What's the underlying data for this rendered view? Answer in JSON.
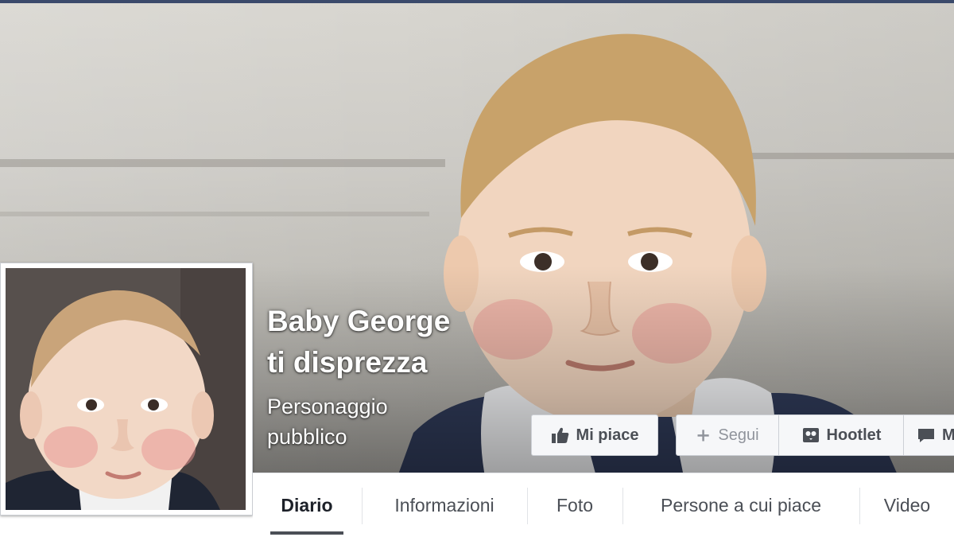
{
  "page": {
    "name_line1": "Baby George",
    "name_line2": "ti disprezza",
    "category_line1": "Personaggio",
    "category_line2": "pubblico"
  },
  "actions": [
    {
      "label": "Mi piace",
      "icon": "thumbs-up-icon"
    },
    {
      "label": "Segui",
      "icon": "plus-icon"
    },
    {
      "label": "Hootlet",
      "icon": "hootlet-icon"
    },
    {
      "label": "M",
      "icon": "message-icon"
    }
  ],
  "tabs": [
    {
      "label": "Diario",
      "active": true
    },
    {
      "label": "Informazioni",
      "active": false
    },
    {
      "label": "Foto",
      "active": false
    },
    {
      "label": "Persone a cui piace",
      "active": false
    },
    {
      "label": "Video",
      "active": false
    }
  ],
  "colors": {
    "top_strip": "#3b4a6b",
    "button_bg": "#f6f7f9",
    "text": "#4b4f56"
  }
}
